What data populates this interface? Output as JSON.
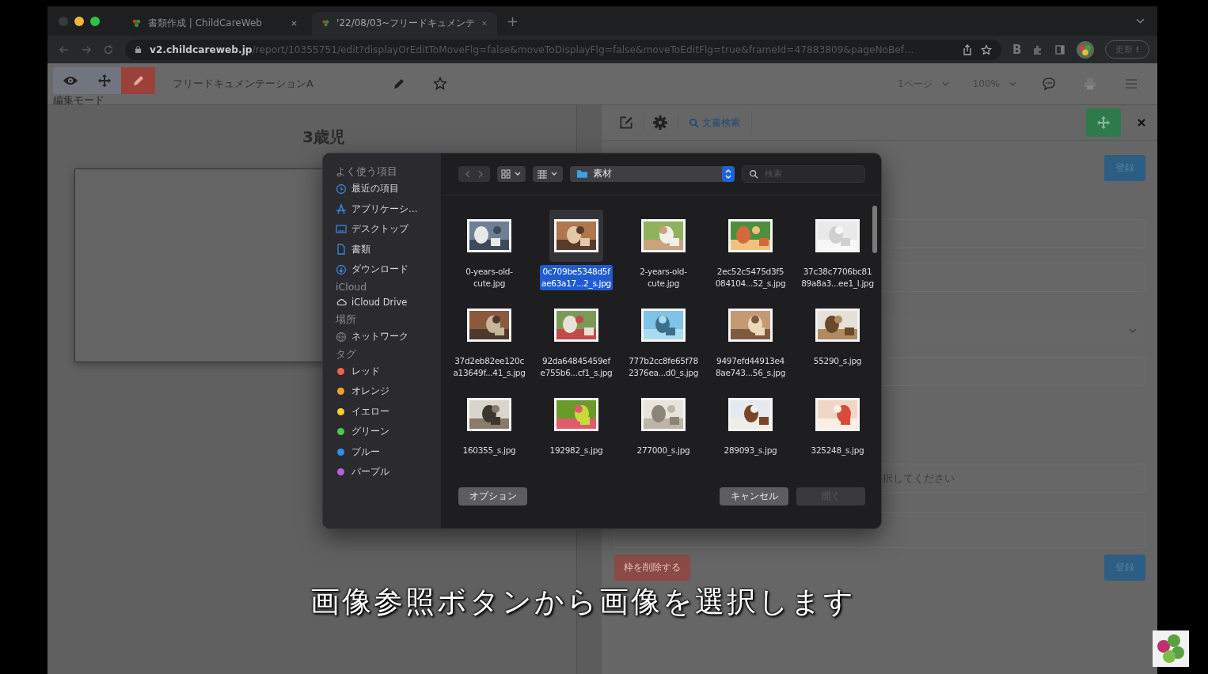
{
  "browser": {
    "tabs": [
      {
        "title": "書類作成 | ChildCareWeb",
        "selected": false
      },
      {
        "title": "'22/08/03~フリードキュメンテ",
        "selected": true
      }
    ],
    "new_tab": "+",
    "url_host": "v2.childcareweb.jp",
    "url_path": "/report/10355751/edit?displayOrEditToMoveFlg=false&moveToDisplayFlg=false&moveToEditFlg=true&frameId=47883809&pageNoBef…",
    "extension_badge": "B",
    "profile_button": "更新",
    "profile_menu": "⁝"
  },
  "toolbar": {
    "modes": [
      {
        "kind": "view",
        "selected": false
      },
      {
        "kind": "move",
        "selected": false
      },
      {
        "kind": "edit",
        "selected": true
      }
    ],
    "mode_label": "編集モード",
    "doc_title": "フリードキュメンテーションA",
    "page_select": "1ページ",
    "zoom_select": "100%"
  },
  "document": {
    "heading": "3歳児"
  },
  "panel": {
    "search_link": "文書検索",
    "submit_top": "登録",
    "select_hint": "択してください",
    "submit_bottom": "登録",
    "delete_button": "枠を削除する"
  },
  "dialog": {
    "sections": [
      {
        "header": "よく使う項目",
        "items": [
          {
            "kind": "recent",
            "label": "最近の項目"
          },
          {
            "kind": "apps",
            "label": "アプリケーシ…"
          },
          {
            "kind": "desktop",
            "label": "デスクトップ"
          },
          {
            "kind": "documents",
            "label": "書類"
          },
          {
            "kind": "downloads",
            "label": "ダウンロード"
          }
        ]
      },
      {
        "header": "iCloud",
        "items": [
          {
            "kind": "icloud",
            "label": "iCloud Drive"
          }
        ]
      },
      {
        "header": "場所",
        "items": [
          {
            "kind": "network",
            "label": "ネットワーク"
          }
        ]
      },
      {
        "header": "タグ",
        "items": [
          {
            "kind": "tag",
            "label": "レッド",
            "color": "#f4604f"
          },
          {
            "kind": "tag",
            "label": "オレンジ",
            "color": "#f5a030"
          },
          {
            "kind": "tag",
            "label": "イエロー",
            "color": "#f5d328"
          },
          {
            "kind": "tag",
            "label": "グリーン",
            "color": "#4cc94a"
          },
          {
            "kind": "tag",
            "label": "ブルー",
            "color": "#2f8ff0"
          },
          {
            "kind": "tag",
            "label": "パープル",
            "color": "#b45fe0"
          }
        ]
      }
    ],
    "location": "素材",
    "search_placeholder": "検索",
    "files": [
      {
        "name_lines": [
          "0-years-old-",
          "cute.jpg"
        ],
        "selected": false
      },
      {
        "name_lines": [
          "0c709be5348d5f",
          "ae63a17...2_s.jpg"
        ],
        "selected": true
      },
      {
        "name_lines": [
          "2-years-old-",
          "cute.jpg"
        ],
        "selected": false
      },
      {
        "name_lines": [
          "2ec52c5475d3f5",
          "084104...52_s.jpg"
        ],
        "selected": false
      },
      {
        "name_lines": [
          "37c38c7706bc81",
          "89a8a3...ee1_l.jpg"
        ],
        "selected": false
      },
      {
        "name_lines": [
          "37d2eb82ee120c",
          "a13649f...41_s.jpg"
        ],
        "selected": false
      },
      {
        "name_lines": [
          "92da64845459ef",
          "e755b6...cf1_s.jpg"
        ],
        "selected": false
      },
      {
        "name_lines": [
          "777b2cc8fe65f78",
          "2376ea...d0_s.jpg"
        ],
        "selected": false
      },
      {
        "name_lines": [
          "9497efd44913e4",
          "8ae743...56_s.jpg"
        ],
        "selected": false
      },
      {
        "name_lines": [
          "55290_s.jpg"
        ],
        "selected": false
      },
      {
        "name_lines": [
          "160355_s.jpg"
        ],
        "selected": false
      },
      {
        "name_lines": [
          "192982_s.jpg"
        ],
        "selected": false
      },
      {
        "name_lines": [
          "277000_s.jpg"
        ],
        "selected": false
      },
      {
        "name_lines": [
          "289093_s.jpg"
        ],
        "selected": false
      },
      {
        "name_lines": [
          "325248_s.jpg"
        ],
        "selected": false
      }
    ],
    "options_button": "オプション",
    "cancel_button": "キャンセル",
    "open_button": {
      "label": "開く",
      "disabled": true
    }
  },
  "subtitle": "画像参照ボタンから画像を選択します"
}
